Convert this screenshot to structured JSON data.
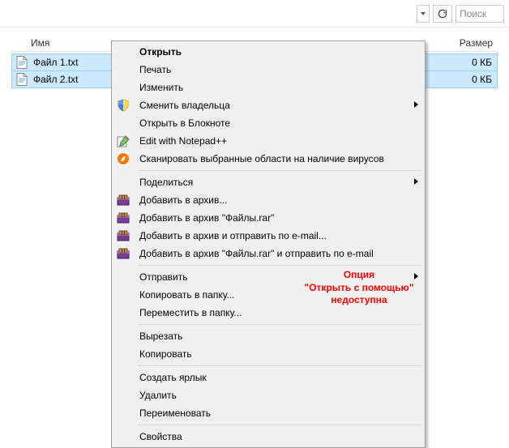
{
  "toolbar": {
    "search_placeholder": "Поиск"
  },
  "columns": {
    "name": "Имя",
    "size": "Размер"
  },
  "files": [
    {
      "name": "Файл 1.txt",
      "size": "0 КБ"
    },
    {
      "name": "Файл 2.txt",
      "size": "0 КБ"
    }
  ],
  "menu": {
    "open": "Открыть",
    "print": "Печать",
    "edit": "Изменить",
    "owner": "Сменить владельца",
    "notepad": "Открыть в Блокноте",
    "npp": "Edit with Notepad++",
    "scan": "Сканировать выбранные области на наличие вирусов",
    "share": "Поделиться",
    "archive": "Добавить в архив...",
    "archive_named": "Добавить в архив \"Файлы.rar\"",
    "archive_email": "Добавить в архив и отправить по e-mail...",
    "archive_named_email": "Добавить в архив \"Файлы.rar\" и отправить по e-mail",
    "send": "Отправить",
    "copyto": "Копировать в папку...",
    "moveto": "Переместить в папку...",
    "cut": "Вырезать",
    "copy": "Копировать",
    "shortcut": "Создать ярлык",
    "delete": "Удалить",
    "rename": "Переименовать",
    "properties": "Свойства"
  },
  "annotation": {
    "l1": "Опция",
    "l2": "\"Открыть с помощью\"",
    "l3": "недоступна"
  }
}
